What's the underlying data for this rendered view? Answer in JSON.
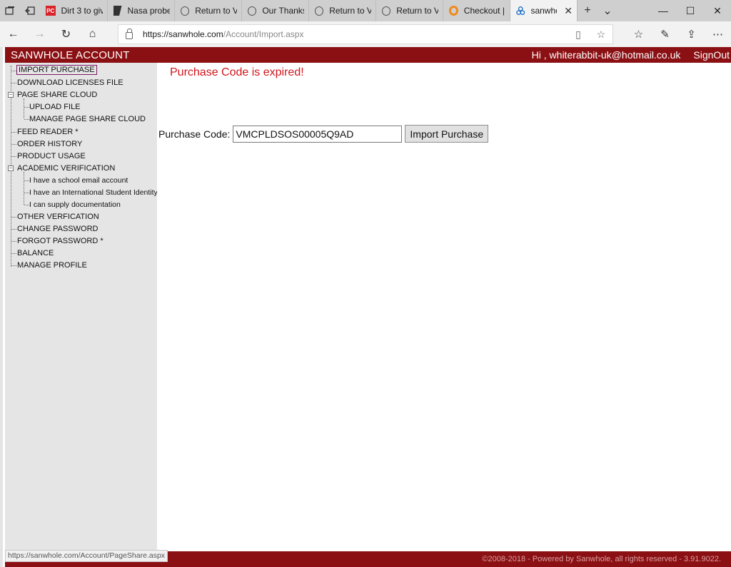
{
  "browser": {
    "tabs": [
      {
        "title": "Dirt 3 to giv",
        "icon": "pc-gamer-icon"
      },
      {
        "title": "Nasa probe",
        "icon": "bookmark-favicon-icon"
      },
      {
        "title": "Return to V’",
        "icon": "loading-circle-icon"
      },
      {
        "title": "Our Thanks",
        "icon": "loading-circle-icon"
      },
      {
        "title": "Return to V’",
        "icon": "loading-circle-icon"
      },
      {
        "title": "Return to V’",
        "icon": "loading-circle-icon"
      },
      {
        "title": "Checkout | S",
        "icon": "orange-ring-icon"
      },
      {
        "title": "sanwho",
        "icon": "site-favicon-icon",
        "active": true
      }
    ],
    "url_host": "https://sanwhole.com",
    "url_path": "/Account/Import.aspx"
  },
  "header": {
    "title": "SANWHOLE ACCOUNT",
    "greeting": "Hi , whiterabbit-uk@hotmail.co.uk",
    "signout": "SignOut"
  },
  "sidebar": {
    "items": [
      {
        "label": "IMPORT PURCHASE"
      },
      {
        "label": "DOWNLOAD LICENSES FILE"
      },
      {
        "label": "PAGE SHARE CLOUD"
      },
      {
        "label": "UPLOAD FILE"
      },
      {
        "label": "MANAGE PAGE SHARE CLOUD"
      },
      {
        "label": "FEED READER *"
      },
      {
        "label": "ORDER HISTORY"
      },
      {
        "label": "PRODUCT USAGE"
      },
      {
        "label": "ACADEMIC VERIFICATION"
      },
      {
        "label": "I have a school email account"
      },
      {
        "label": "I have an International Student Identity Card"
      },
      {
        "label": "I can supply documentation"
      },
      {
        "label": "OTHER VERFICATION"
      },
      {
        "label": "CHANGE PASSWORD"
      },
      {
        "label": "FORGOT PASSWORD *"
      },
      {
        "label": "BALANCE"
      },
      {
        "label": "MANAGE PROFILE"
      }
    ]
  },
  "main": {
    "error": "Purchase Code is expired!",
    "code_label": "Purchase Code:",
    "code_value": "VMCPLDSOS00005Q9AD",
    "import_button": "Import Purchase"
  },
  "footer": {
    "text": "©2008-2018 - Powered by Sanwhole, all rights reserved - 3.91.9022."
  },
  "status_bar": {
    "url": "https://sanwhole.com/Account/PageShare.aspx"
  },
  "colors": {
    "brand": "#8b1014",
    "error": "#d0161c",
    "sidebar_bg": "#e5e5e5"
  }
}
